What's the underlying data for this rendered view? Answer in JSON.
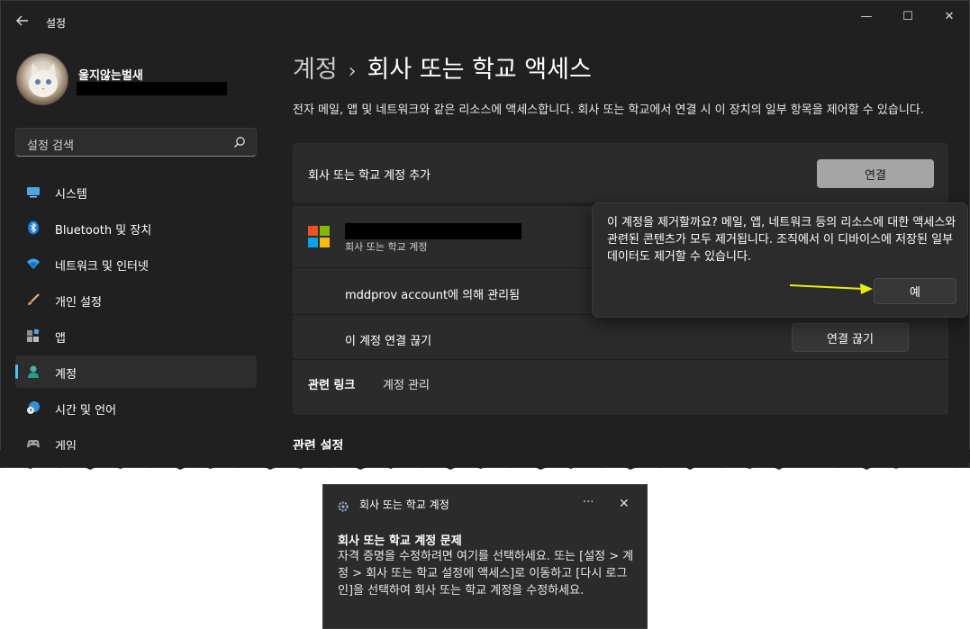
{
  "window": {
    "title": "설정",
    "controls": {
      "minimize": "—",
      "maximize": "☐",
      "close": "✕"
    }
  },
  "user": {
    "name": "울지않는벌새"
  },
  "search": {
    "placeholder": "설정 검색"
  },
  "nav": [
    {
      "label": "시스템",
      "icon": "system-icon"
    },
    {
      "label": "Bluetooth 및 장치",
      "icon": "bluetooth-icon"
    },
    {
      "label": "네트워크 및 인터넷",
      "icon": "network-icon"
    },
    {
      "label": "개인 설정",
      "icon": "brush-icon"
    },
    {
      "label": "앱",
      "icon": "apps-icon"
    },
    {
      "label": "계정",
      "icon": "account-icon",
      "active": true
    },
    {
      "label": "시간 및 언어",
      "icon": "globe-clock-icon"
    },
    {
      "label": "게임",
      "icon": "gamepad-icon"
    }
  ],
  "main": {
    "breadcrumb_parent": "계정",
    "breadcrumb_sep": "›",
    "breadcrumb_current": "회사 또는 학교 액세스",
    "description": "전자 메일, 앱 및 네트워크와 같은 리소스에 액세스합니다. 회사 또는 학교에서 연결 시 이 장치의 일부 항목을 제어할 수 있습니다.",
    "add_account_label": "회사 또는 학교 계정 추가",
    "connect_button": "연결",
    "account_type": "회사 또는 학교 계정",
    "managed_by": "mddprov account에 의해 관리됨",
    "disconnect_label": "이 계정 연결 끊기",
    "disconnect_button": "연결 끊기",
    "related_links_label": "관련 링크",
    "manage_account_link": "계정 관리",
    "related_settings": "관련 설정"
  },
  "popup": {
    "message": "이 계정을 제거할까요? 메일, 앱, 네트워크 등의 리소스에 대한 액세스와 관련된 콘텐츠가 모두 제거됩니다. 조직에서 이 디바이스에 저장된 일부 데이터도 제거할 수 있습니다.",
    "yes_button": "예"
  },
  "notification": {
    "app_title": "회사 또는 학교 계정",
    "more": "···",
    "close": "✕",
    "heading": "회사 또는 학교 계정 문제",
    "body": "자격 증명을 수정하려면 여기를 선택하세요. 또는 [설정 > 계정 > 회사 또는 학교 설정에 액세스]로 이동하고 [다시 로그인]을 선택하여 회사 또는 학교 계정을 수정하세요."
  },
  "colors": {
    "window_bg": "#202020",
    "card_bg": "#2b2b2b",
    "accent": "#4cc2ff",
    "annotation_arrow": "#e8f000"
  }
}
